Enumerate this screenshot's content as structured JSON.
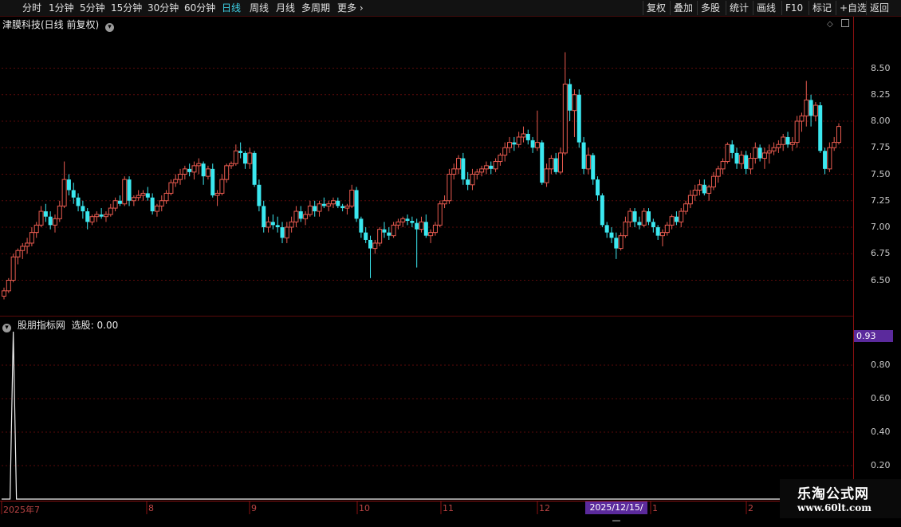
{
  "toolbar": {
    "periods": [
      {
        "label": "分时",
        "active": false
      },
      {
        "label": "1分钟",
        "active": false
      },
      {
        "label": "5分钟",
        "active": false
      },
      {
        "label": "15分钟",
        "active": false
      },
      {
        "label": "30分钟",
        "active": false
      },
      {
        "label": "60分钟",
        "active": false
      },
      {
        "label": "日线",
        "active": true
      },
      {
        "label": "周线",
        "active": false
      },
      {
        "label": "月线",
        "active": false
      },
      {
        "label": "多周期",
        "active": false
      },
      {
        "label": "更多",
        "active": false
      }
    ],
    "actions": [
      "复权",
      "叠加",
      "多股",
      "统计",
      "画线",
      "F10",
      "标记",
      "+自选",
      "返回"
    ]
  },
  "main_chart": {
    "title": "津膜科技(日线 前复权)"
  },
  "indicator": {
    "title": "股朋指标网",
    "value_label": "选股: 0.00",
    "current_value_badge": "0.93"
  },
  "cursor_date": "2025/12/15/—",
  "watermark": {
    "line1": "乐淘公式网",
    "line2": "www.60lt.com"
  },
  "chart_data": [
    {
      "type": "candlestick",
      "title": "津膜科技(日线 前复权)",
      "y_ticks": [
        6.5,
        6.75,
        7.0,
        7.25,
        7.5,
        7.75,
        8.0,
        8.25,
        8.5
      ],
      "ylim": [
        6.3,
        9.1
      ],
      "x_tick_labels": [
        "2025年7",
        "8",
        "9",
        "10",
        "11",
        "12",
        "1",
        "2"
      ],
      "colors": {
        "up": "#e85a4f",
        "down": "#3be8f0"
      },
      "candles": [
        [
          6.35,
          6.43,
          6.32,
          6.4
        ],
        [
          6.4,
          6.52,
          6.38,
          6.5
        ],
        [
          6.5,
          6.75,
          6.48,
          6.72
        ],
        [
          6.72,
          6.8,
          6.65,
          6.78
        ],
        [
          6.78,
          6.85,
          6.7,
          6.82
        ],
        [
          6.82,
          6.9,
          6.75,
          6.85
        ],
        [
          6.85,
          7.0,
          6.82,
          6.95
        ],
        [
          6.95,
          7.05,
          6.9,
          7.02
        ],
        [
          7.02,
          7.2,
          7.0,
          7.15
        ],
        [
          7.15,
          7.22,
          7.05,
          7.1
        ],
        [
          7.1,
          7.15,
          6.98,
          7.02
        ],
        [
          7.02,
          7.12,
          6.95,
          7.08
        ],
        [
          7.08,
          7.25,
          7.05,
          7.2
        ],
        [
          7.2,
          7.62,
          7.18,
          7.45
        ],
        [
          7.45,
          7.5,
          7.3,
          7.35
        ],
        [
          7.35,
          7.42,
          7.22,
          7.28
        ],
        [
          7.28,
          7.32,
          7.15,
          7.2
        ],
        [
          7.2,
          7.25,
          7.08,
          7.15
        ],
        [
          7.15,
          7.18,
          6.98,
          7.05
        ],
        [
          7.05,
          7.12,
          7.02,
          7.1
        ],
        [
          7.1,
          7.15,
          7.05,
          7.12
        ],
        [
          7.12,
          7.18,
          7.08,
          7.1
        ],
        [
          7.1,
          7.15,
          7.05,
          7.12
        ],
        [
          7.12,
          7.22,
          7.1,
          7.18
        ],
        [
          7.18,
          7.28,
          7.15,
          7.25
        ],
        [
          7.25,
          7.3,
          7.2,
          7.22
        ],
        [
          7.22,
          7.48,
          7.2,
          7.45
        ],
        [
          7.45,
          7.48,
          7.2,
          7.25
        ],
        [
          7.25,
          7.3,
          7.2,
          7.28
        ],
        [
          7.28,
          7.35,
          7.25,
          7.3
        ],
        [
          7.3,
          7.35,
          7.25,
          7.32
        ],
        [
          7.32,
          7.38,
          7.25,
          7.28
        ],
        [
          7.28,
          7.32,
          7.12,
          7.15
        ],
        [
          7.15,
          7.22,
          7.1,
          7.2
        ],
        [
          7.2,
          7.3,
          7.15,
          7.25
        ],
        [
          7.25,
          7.35,
          7.22,
          7.32
        ],
        [
          7.32,
          7.45,
          7.3,
          7.42
        ],
        [
          7.42,
          7.5,
          7.38,
          7.45
        ],
        [
          7.45,
          7.55,
          7.4,
          7.5
        ],
        [
          7.5,
          7.58,
          7.45,
          7.55
        ],
        [
          7.55,
          7.6,
          7.48,
          7.52
        ],
        [
          7.52,
          7.62,
          7.45,
          7.58
        ],
        [
          7.58,
          7.65,
          7.5,
          7.6
        ],
        [
          7.6,
          7.62,
          7.4,
          7.48
        ],
        [
          7.48,
          7.58,
          7.45,
          7.55
        ],
        [
          7.55,
          7.6,
          7.28,
          7.3
        ],
        [
          7.3,
          7.35,
          7.2,
          7.32
        ],
        [
          7.32,
          7.5,
          7.3,
          7.45
        ],
        [
          7.45,
          7.6,
          7.42,
          7.58
        ],
        [
          7.58,
          7.62,
          7.55,
          7.6
        ],
        [
          7.6,
          7.78,
          7.58,
          7.72
        ],
        [
          7.72,
          7.8,
          7.65,
          7.7
        ],
        [
          7.7,
          7.72,
          7.55,
          7.6
        ],
        [
          7.6,
          7.75,
          7.55,
          7.7
        ],
        [
          7.7,
          7.72,
          7.38,
          7.4
        ],
        [
          7.4,
          7.45,
          7.15,
          7.2
        ],
        [
          7.2,
          7.25,
          6.95,
          7.0
        ],
        [
          7.0,
          7.1,
          6.95,
          7.05
        ],
        [
          7.05,
          7.12,
          6.98,
          7.02
        ],
        [
          7.02,
          7.1,
          6.95,
          7.0
        ],
        [
          7.0,
          7.05,
          6.85,
          6.9
        ],
        [
          6.9,
          7.05,
          6.85,
          7.0
        ],
        [
          7.0,
          7.1,
          6.95,
          7.05
        ],
        [
          7.05,
          7.2,
          7.0,
          7.15
        ],
        [
          7.15,
          7.2,
          7.05,
          7.08
        ],
        [
          7.08,
          7.15,
          7.02,
          7.12
        ],
        [
          7.12,
          7.25,
          7.1,
          7.2
        ],
        [
          7.2,
          7.25,
          7.1,
          7.15
        ],
        [
          7.15,
          7.25,
          7.1,
          7.22
        ],
        [
          7.22,
          7.28,
          7.18,
          7.2
        ],
        [
          7.2,
          7.25,
          7.15,
          7.22
        ],
        [
          7.22,
          7.28,
          7.18,
          7.25
        ],
        [
          7.25,
          7.28,
          7.18,
          7.2
        ],
        [
          7.2,
          7.22,
          7.15,
          7.18
        ],
        [
          7.18,
          7.22,
          7.12,
          7.2
        ],
        [
          7.2,
          7.4,
          7.18,
          7.35
        ],
        [
          7.35,
          7.38,
          7.05,
          7.08
        ],
        [
          7.08,
          7.1,
          6.9,
          6.95
        ],
        [
          6.95,
          7.0,
          6.85,
          6.88
        ],
        [
          6.88,
          6.92,
          6.52,
          6.8
        ],
        [
          6.8,
          6.88,
          6.75,
          6.85
        ],
        [
          6.85,
          7.0,
          6.82,
          6.98
        ],
        [
          6.98,
          7.05,
          6.9,
          6.95
        ],
        [
          6.95,
          7.0,
          6.88,
          6.92
        ],
        [
          6.92,
          7.05,
          6.9,
          7.02
        ],
        [
          7.02,
          7.08,
          6.98,
          7.05
        ],
        [
          7.05,
          7.1,
          7.0,
          7.08
        ],
        [
          7.08,
          7.12,
          7.02,
          7.06
        ],
        [
          7.06,
          7.1,
          7.0,
          7.04
        ],
        [
          7.04,
          7.08,
          6.62,
          6.98
        ],
        [
          6.98,
          7.1,
          6.95,
          7.05
        ],
        [
          7.05,
          7.12,
          6.9,
          6.92
        ],
        [
          6.92,
          6.98,
          6.85,
          6.95
        ],
        [
          6.95,
          7.05,
          6.92,
          7.02
        ],
        [
          7.02,
          7.25,
          7.0,
          7.22
        ],
        [
          7.22,
          7.3,
          7.18,
          7.25
        ],
        [
          7.25,
          7.55,
          7.22,
          7.5
        ],
        [
          7.5,
          7.6,
          7.45,
          7.55
        ],
        [
          7.55,
          7.68,
          7.5,
          7.65
        ],
        [
          7.65,
          7.7,
          7.4,
          7.45
        ],
        [
          7.45,
          7.52,
          7.35,
          7.4
        ],
        [
          7.4,
          7.55,
          7.35,
          7.5
        ],
        [
          7.5,
          7.55,
          7.45,
          7.52
        ],
        [
          7.52,
          7.58,
          7.48,
          7.55
        ],
        [
          7.55,
          7.62,
          7.5,
          7.58
        ],
        [
          7.58,
          7.62,
          7.5,
          7.55
        ],
        [
          7.55,
          7.65,
          7.52,
          7.62
        ],
        [
          7.62,
          7.7,
          7.58,
          7.68
        ],
        [
          7.68,
          7.8,
          7.62,
          7.75
        ],
        [
          7.75,
          7.85,
          7.7,
          7.8
        ],
        [
          7.8,
          7.85,
          7.72,
          7.78
        ],
        [
          7.78,
          7.9,
          7.75,
          7.85
        ],
        [
          7.85,
          7.95,
          7.8,
          7.88
        ],
        [
          7.88,
          7.92,
          7.78,
          7.82
        ],
        [
          7.82,
          7.85,
          7.7,
          7.75
        ],
        [
          7.75,
          8.1,
          7.72,
          7.8
        ],
        [
          7.8,
          7.82,
          7.4,
          7.42
        ],
        [
          7.42,
          7.6,
          7.38,
          7.55
        ],
        [
          7.55,
          7.68,
          7.5,
          7.65
        ],
        [
          7.65,
          7.7,
          7.5,
          7.52
        ],
        [
          7.52,
          7.75,
          7.5,
          7.7
        ],
        [
          7.7,
          8.65,
          7.68,
          8.35
        ],
        [
          8.35,
          8.4,
          8.0,
          8.1
        ],
        [
          8.1,
          8.3,
          7.85,
          8.25
        ],
        [
          8.25,
          8.3,
          7.75,
          7.8
        ],
        [
          7.8,
          7.85,
          7.5,
          7.55
        ],
        [
          7.55,
          7.75,
          7.5,
          7.68
        ],
        [
          7.68,
          7.7,
          7.4,
          7.45
        ],
        [
          7.45,
          7.48,
          7.25,
          7.3
        ],
        [
          7.3,
          7.32,
          7.0,
          7.02
        ],
        [
          7.02,
          7.05,
          6.9,
          6.95
        ],
        [
          6.95,
          7.0,
          6.85,
          6.9
        ],
        [
          6.9,
          6.95,
          6.7,
          6.8
        ],
        [
          6.8,
          6.95,
          6.78,
          6.92
        ],
        [
          6.92,
          7.1,
          6.9,
          7.05
        ],
        [
          7.05,
          7.18,
          7.0,
          7.15
        ],
        [
          7.15,
          7.18,
          7.0,
          7.05
        ],
        [
          7.05,
          7.1,
          6.98,
          7.02
        ],
        [
          7.02,
          7.18,
          7.0,
          7.15
        ],
        [
          7.15,
          7.18,
          7.02,
          7.05
        ],
        [
          7.05,
          7.08,
          6.95,
          7.0
        ],
        [
          7.0,
          7.02,
          6.88,
          6.92
        ],
        [
          6.92,
          6.98,
          6.82,
          6.95
        ],
        [
          6.95,
          7.05,
          6.92,
          7.02
        ],
        [
          7.02,
          7.12,
          6.98,
          7.1
        ],
        [
          7.1,
          7.15,
          7.02,
          7.05
        ],
        [
          7.05,
          7.18,
          7.0,
          7.15
        ],
        [
          7.15,
          7.25,
          7.12,
          7.22
        ],
        [
          7.22,
          7.35,
          7.18,
          7.3
        ],
        [
          7.3,
          7.4,
          7.25,
          7.35
        ],
        [
          7.35,
          7.45,
          7.3,
          7.4
        ],
        [
          7.4,
          7.45,
          7.3,
          7.32
        ],
        [
          7.32,
          7.4,
          7.25,
          7.38
        ],
        [
          7.38,
          7.52,
          7.35,
          7.48
        ],
        [
          7.48,
          7.58,
          7.42,
          7.55
        ],
        [
          7.55,
          7.65,
          7.5,
          7.62
        ],
        [
          7.62,
          7.8,
          7.6,
          7.78
        ],
        [
          7.78,
          7.82,
          7.65,
          7.7
        ],
        [
          7.7,
          7.75,
          7.55,
          7.6
        ],
        [
          7.6,
          7.72,
          7.55,
          7.68
        ],
        [
          7.68,
          7.72,
          7.5,
          7.55
        ],
        [
          7.55,
          7.7,
          7.5,
          7.65
        ],
        [
          7.65,
          7.8,
          7.6,
          7.75
        ],
        [
          7.75,
          7.78,
          7.62,
          7.65
        ],
        [
          7.65,
          7.75,
          7.55,
          7.7
        ],
        [
          7.7,
          7.78,
          7.6,
          7.72
        ],
        [
          7.72,
          7.8,
          7.68,
          7.75
        ],
        [
          7.75,
          7.82,
          7.7,
          7.78
        ],
        [
          7.78,
          7.88,
          7.72,
          7.85
        ],
        [
          7.85,
          7.9,
          7.75,
          7.78
        ],
        [
          7.78,
          7.85,
          7.72,
          7.8
        ],
        [
          7.8,
          8.05,
          7.75,
          8.0
        ],
        [
          8.0,
          8.08,
          7.9,
          8.05
        ],
        [
          8.05,
          8.38,
          7.95,
          8.2
        ],
        [
          8.2,
          8.25,
          7.95,
          8.05
        ],
        [
          8.05,
          8.18,
          8.0,
          8.15
        ],
        [
          8.15,
          8.18,
          7.7,
          7.72
        ],
        [
          7.72,
          7.75,
          7.5,
          7.55
        ],
        [
          7.55,
          7.8,
          7.52,
          7.75
        ],
        [
          7.75,
          7.85,
          7.72,
          7.8
        ],
        [
          7.8,
          7.98,
          7.78,
          7.95
        ]
      ]
    },
    {
      "type": "line",
      "title": "股朋指标网",
      "y_ticks": [
        0.2,
        0.4,
        0.6,
        0.8
      ],
      "ylim": [
        0,
        1.0
      ],
      "spike": {
        "index": 2,
        "value": 1.0
      }
    }
  ]
}
